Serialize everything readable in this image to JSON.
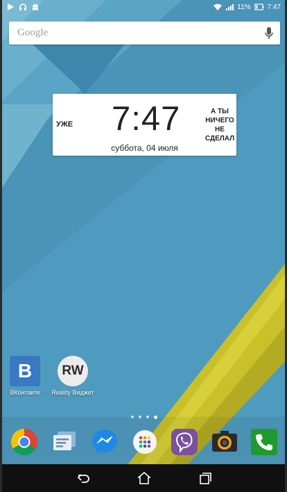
{
  "status_bar": {
    "battery_percent": "11%",
    "time": "7:47",
    "left_icons": [
      "play-icon",
      "headset-icon",
      "android-icon"
    ],
    "right_icons": [
      "wifi-icon",
      "signal-icon",
      "battery-icon"
    ]
  },
  "search_bar": {
    "label": "Google",
    "mic_icon": "mic-icon"
  },
  "clock_widget": {
    "left_text": "УЖЕ",
    "time": "7:47",
    "right_text_lines": [
      "А ТЫ",
      "НИЧЕГО",
      "НЕ",
      "СДЕЛАЛ"
    ],
    "date": "суббота, 04 июля"
  },
  "desktop_apps": [
    {
      "label": "ВКонтакте",
      "icon_text": "B",
      "icon": "vk-icon"
    },
    {
      "label": "Reality Виджет",
      "icon_text": "RW",
      "icon": "reality-widget-icon"
    }
  ],
  "page_indicator": {
    "count": 4,
    "active_index": 3
  },
  "dock": [
    {
      "name": "chrome-icon"
    },
    {
      "name": "messages-icon"
    },
    {
      "name": "messenger-icon"
    },
    {
      "name": "app-drawer-icon"
    },
    {
      "name": "viber-icon"
    },
    {
      "name": "camera-icon"
    },
    {
      "name": "phone-icon"
    }
  ],
  "nav_bar": [
    "back-icon",
    "home-icon",
    "recents-icon"
  ],
  "colors": {
    "wallpaper_blue": "#4f9bbf",
    "wallpaper_yellow": "#c9c12a",
    "vk_blue": "#3a78c3",
    "phone_green": "#1e9a2e"
  }
}
